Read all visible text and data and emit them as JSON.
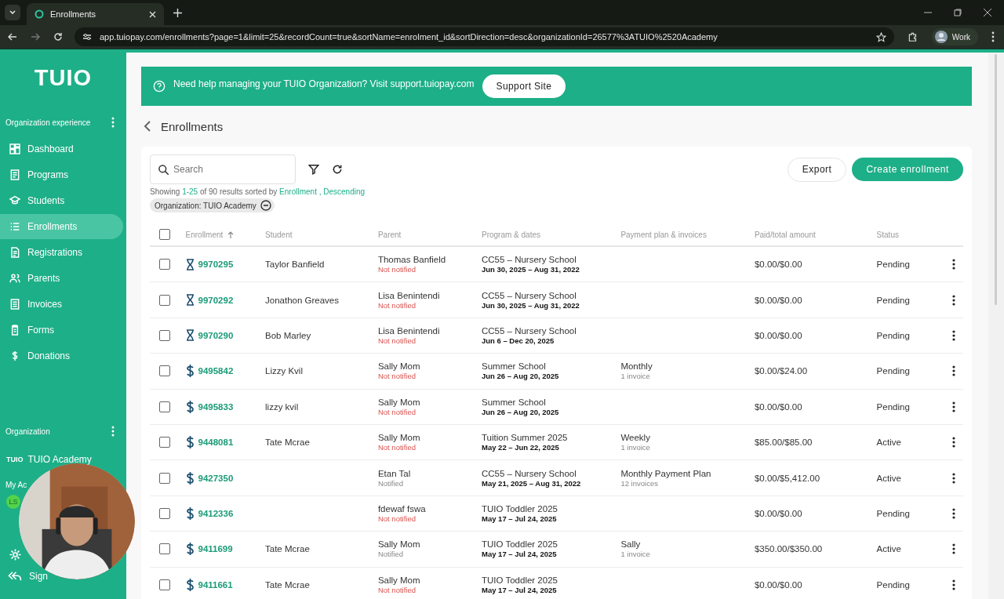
{
  "browser": {
    "tab_title": "Enrollments",
    "url": "app.tuiopay.com/enrollments?page=1&limit=25&recordCount=true&sortName=enrolment_id&sortDirection=desc&organizationId=26577%3ATUIO%2520Academy",
    "profile": "Work"
  },
  "sidebar": {
    "logo": "TUIO",
    "section_title": "Organization experience",
    "items": [
      {
        "label": "Dashboard",
        "selected": false
      },
      {
        "label": "Programs",
        "selected": false
      },
      {
        "label": "Students",
        "selected": false
      },
      {
        "label": "Enrollments",
        "selected": true
      },
      {
        "label": "Registrations",
        "selected": false
      },
      {
        "label": "Parents",
        "selected": false
      },
      {
        "label": "Invoices",
        "selected": false
      },
      {
        "label": "Forms",
        "selected": false
      },
      {
        "label": "Donations",
        "selected": false
      }
    ],
    "org_title": "Organization",
    "org_logo": "TUIO",
    "org_name": "TUIO Academy",
    "account_title": "My Ac",
    "avatar": "LS",
    "sign_out": "Sign"
  },
  "banner": {
    "text": "Need help managing your TUIO Organization? Visit support.tuiopay.com",
    "button": "Support Site"
  },
  "page_title": "Enrollments",
  "search": {
    "placeholder": "Search"
  },
  "summary": {
    "prefix": "Showing ",
    "range": "1-25",
    "middle": " of 90 results sorted by ",
    "sort_field": "Enrollment ,",
    "sort_dir": "Descending"
  },
  "filter_chip": "Organization: TUIO Academy",
  "buttons": {
    "export": "Export",
    "create": "Create enrollment"
  },
  "table": {
    "select_all": {
      "checked": false
    },
    "columns": [
      "Enrollment",
      "Student",
      "Parent",
      "Program & dates",
      "Payment plan & invoices",
      "Paid/total amount",
      "Status"
    ],
    "rows": [
      {
        "checked": false,
        "kind": "waiting",
        "id": "9970295",
        "student": "Taylor Banfield",
        "parent": "Thomas Banfield",
        "notice": "Not notified",
        "notified": false,
        "program": "CC55 – Nursery School",
        "dates": "Jun 30, 2025 – Aug 31, 2022",
        "amount": "$0.00/$0.00",
        "status": "Pending"
      },
      {
        "checked": false,
        "kind": "waiting",
        "id": "9970292",
        "student": "Jonathon Greaves",
        "parent": "Lisa Benintendi",
        "notice": "Not notified",
        "notified": false,
        "program": "CC55 – Nursery School",
        "dates": "Jun 30, 2025 – Aug 31, 2022",
        "amount": "$0.00/$0.00",
        "status": "Pending"
      },
      {
        "checked": false,
        "kind": "waiting",
        "id": "9970290",
        "student": "Bob Marley",
        "parent": "Lisa Benintendi",
        "notice": "Not notified",
        "notified": false,
        "program": "CC55 – Nursery School",
        "dates": "Jun 6 – Dec 20, 2025",
        "amount": "$0.00/$0.00",
        "status": "Pending"
      },
      {
        "checked": false,
        "kind": "payment",
        "id": "9495842",
        "student": "Lizzy Kvil",
        "parent": "Sally Mom",
        "notice": "Not notified",
        "notified": false,
        "program": "Summer School",
        "dates": "Jun 26 – Aug 20, 2025",
        "plan": "Monthly",
        "invoices": "1 invoice",
        "amount": "$0.00/$24.00",
        "status": "Pending"
      },
      {
        "checked": false,
        "kind": "payment",
        "id": "9495833",
        "student": "lizzy kvil",
        "parent": "Sally Mom",
        "notice": "Not notified",
        "notified": false,
        "program": "Summer School",
        "dates": "Jun 26 – Aug 20, 2025",
        "amount": "$0.00/$0.00",
        "status": "Pending"
      },
      {
        "checked": false,
        "kind": "payment",
        "id": "9448081",
        "student": "Tate Mcrae",
        "parent": "Sally Mom",
        "notice": "Not notified",
        "notified": false,
        "program": "Tuition Summer 2025",
        "dates": "May 22 – Jun 22, 2025",
        "plan": "Weekly",
        "invoices": "1 invoice",
        "amount": "$85.00/$85.00",
        "status": "Active"
      },
      {
        "checked": false,
        "kind": "payment",
        "id": "9427350",
        "parent": "Etan Tal",
        "notice": "Notified",
        "notified": true,
        "program": "CC55 – Nursery School",
        "dates": "May 21, 2025 – Aug 31, 2022",
        "plan": "Monthly Payment Plan",
        "invoices": "12 invoices",
        "amount": "$0.00/$5,412.00",
        "status": "Active"
      },
      {
        "checked": false,
        "kind": "payment",
        "id": "9412336",
        "parent": "fdewaf fswa",
        "notice": "Not notified",
        "notified": false,
        "program": "TUIO Toddler 2025",
        "dates": "May 17 – Jul 24, 2025",
        "amount": "$0.00/$0.00",
        "status": "Pending"
      },
      {
        "checked": false,
        "kind": "payment",
        "id": "9411699",
        "student": "Tate Mcrae",
        "parent": "Sally Mom",
        "notice": "Notified",
        "notified": true,
        "program": "TUIO Toddler 2025",
        "dates": "May 17 – Jul 24, 2025",
        "plan": "Sally",
        "invoices": "1 invoice",
        "amount": "$350.00/$350.00",
        "status": "Active"
      },
      {
        "checked": false,
        "kind": "payment",
        "id": "9411661",
        "student": "Tate Mcrae",
        "parent": "Sally Mom",
        "notice": "Not notified",
        "notified": false,
        "program": "TUIO Toddler 2025",
        "dates": "May 17 – Jul 24, 2025",
        "amount": "$0.00/$0.00",
        "status": "Pending"
      }
    ]
  }
}
